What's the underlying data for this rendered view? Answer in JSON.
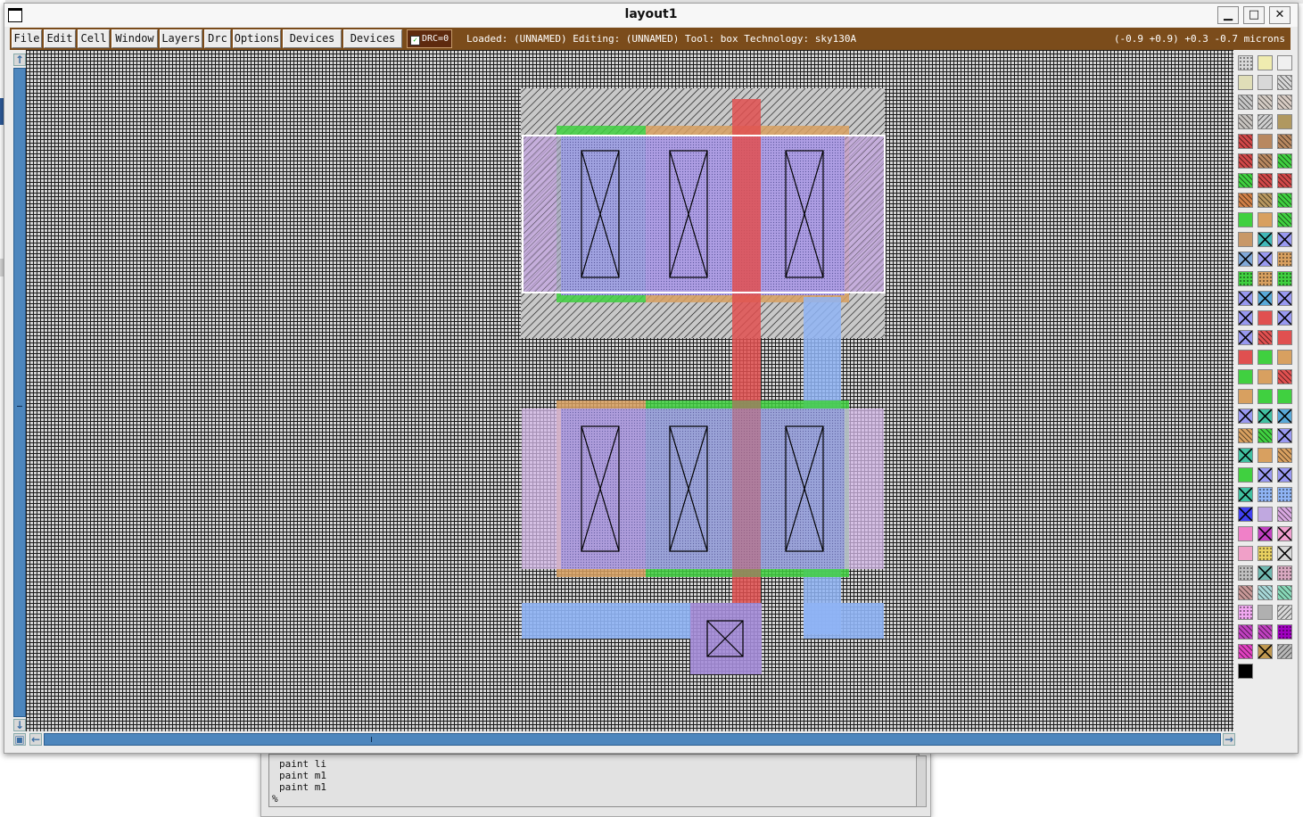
{
  "window": {
    "title": "layout1",
    "buttons": {
      "minimize": "▁",
      "maximize": "□",
      "close": "✕"
    }
  },
  "menubar": {
    "items": [
      "File",
      "Edit",
      "Cell",
      "Window",
      "Layers",
      "Drc",
      "Options",
      "Devices 1",
      "Devices 2"
    ],
    "drc_label": "DRC=0",
    "drc_checked": true,
    "status": "Loaded: (UNNAMED) Editing: (UNNAMED) Tool: box  Technology: sky130A",
    "coordinates": "(-0.9 +0.9) +0.3 -0.7 microns"
  },
  "console": {
    "lines": [
      "paint li",
      "paint m1",
      "paint m1",
      "%"
    ]
  },
  "colors": {
    "menubar": "#7b4c1b",
    "drc_button": "#5e2a0e",
    "scrollbar": "#4d86bd",
    "grid_bg": "#d6d6d6",
    "metal1": "#8fb4f5",
    "poly": "#e05050",
    "ndiff": "#40d040",
    "pdiff": "#d0a060",
    "local_interconnect": "#a88ce8",
    "nwell": "#b0b0b0",
    "selection_box": "#ffffff"
  },
  "palette": {
    "rows": [
      [
        "#d8d8d8:dot",
        "#f0ecb0:plain",
        "#f0f0f0:box"
      ],
      [
        "#e0deb8:plain",
        "#d8d8d8:plain",
        "#d8d8d8:hatch"
      ],
      [
        "#c8c8c8:hatch",
        "#d4ccc4:hatch",
        "#d8ccc4:hatch"
      ],
      [
        "#c8c4c0:hatch",
        "#d0d0d0:hatch2",
        "#b09860:plain"
      ],
      [
        "#d04848:hatch",
        "#b88860:plain",
        "#b88860:hatch"
      ],
      [
        "#d04848:hatch",
        "#b88860:hatch",
        "#40d040:hatch"
      ],
      [
        "#40d040:hatch",
        "#d04848:hatch",
        "#d04848:hatch"
      ],
      [
        "#d08048:hatch",
        "#b89860:hatch",
        "#40d040:hatch"
      ],
      [
        "#40d040:plain",
        "#d8a060:plain",
        "#40d040:hatch"
      ],
      [
        "#c89868:plain",
        "#40b8b8:x",
        "#9898f0:x"
      ],
      [
        "#80a8d8:x",
        "#9898f0:x",
        "#d8a060:dot"
      ],
      [
        "#40d040:dot",
        "#d8a060:dot",
        "#40d040:dot"
      ],
      [
        "#9898f0:x",
        "#58a8d8:x",
        "#9898f0:x"
      ],
      [
        "#9898f0:x",
        "#e05050:plain",
        "#9898f0:x"
      ],
      [
        "#9898f0:x",
        "#e05050:hatch",
        "#e05050:plain"
      ],
      [
        "#e05050:plain",
        "#40d040:plain",
        "#d8a060:plain"
      ],
      [
        "#40d040:plain",
        "#d8a060:plain",
        "#e05050:hatch"
      ],
      [
        "#d8a060:plain",
        "#40d040:plain",
        "#40d040:plain"
      ],
      [
        "#9898f0:x",
        "#40c0a0:x",
        "#58a8d8:x"
      ],
      [
        "#d8a060:hatch",
        "#40d040:hatch",
        "#9898f0:x"
      ],
      [
        "#40c0a0:x",
        "#d8a060:plain",
        "#d8a060:hatch"
      ],
      [
        "#40d040:plain",
        "#9898f0:x",
        "#9898f0:x"
      ],
      [
        "#40c0a0:x",
        "#8fb4f5:dot",
        "#8fb4f5:dot"
      ],
      [
        "#4040f0:x",
        "#c0a8e0:plain",
        "#d8a8e0:hatch"
      ],
      [
        "#f080c8:plain",
        "#c040c0:x",
        "#f0a0d0:x"
      ],
      [
        "#f0a0c8:plain",
        "#e8d060:dot",
        "#d8d8d8:x"
      ],
      [
        "#c0c0c0:dot",
        "#70b8b0:x",
        "#d8a8c0:dot"
      ],
      [
        "#c89898:hatch",
        "#a8d8d8:hatch",
        "#88d8b8:hatch"
      ],
      [
        "#f0a8f0:dot",
        "#b0b0b0:plain",
        "#d8d8d8:hatch2"
      ],
      [
        "#c040c0:hatch",
        "#c040c0:hatch",
        "#a000c0:dot"
      ],
      [
        "#e040c0:hatch",
        "#c09850:x",
        "#b8b8b8:hatch2"
      ],
      [
        "#000000:plain"
      ]
    ]
  }
}
